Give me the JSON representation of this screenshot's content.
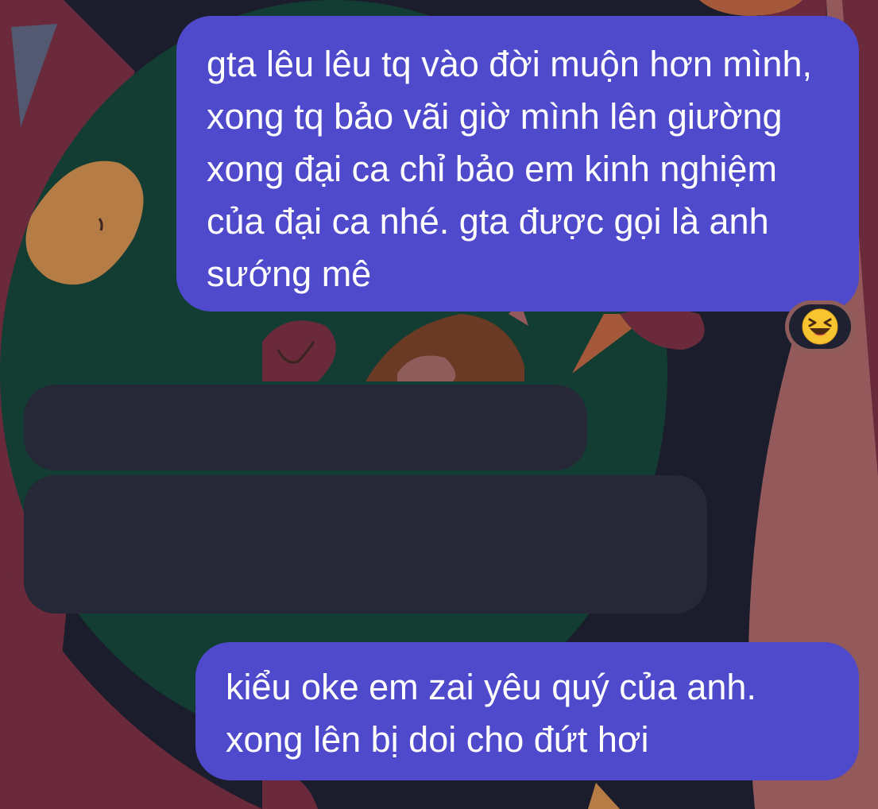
{
  "messages": [
    {
      "id": "msg1",
      "direction": "sent",
      "text": "gta lêu lêu tq vào đời muộn hơn mình, xong tq bảo vãi giờ mình lên giường xong đại ca chỉ bảo em kinh nghiệm của đại ca nhé. gta được gọi là anh sướng mê",
      "reaction": "laughing-squinting-face-emoji"
    },
    {
      "id": "msg2",
      "direction": "received",
      "text": ""
    },
    {
      "id": "msg3",
      "direction": "received",
      "text": ""
    },
    {
      "id": "msg4",
      "direction": "sent",
      "text": "kiểu oke em zai yêu quý của anh. xong lên bị doi cho đứt hơi"
    }
  ],
  "colors": {
    "sent_bubble": "#4e4acb",
    "received_bubble": "#262737",
    "background_base": "#1b1d2c"
  }
}
